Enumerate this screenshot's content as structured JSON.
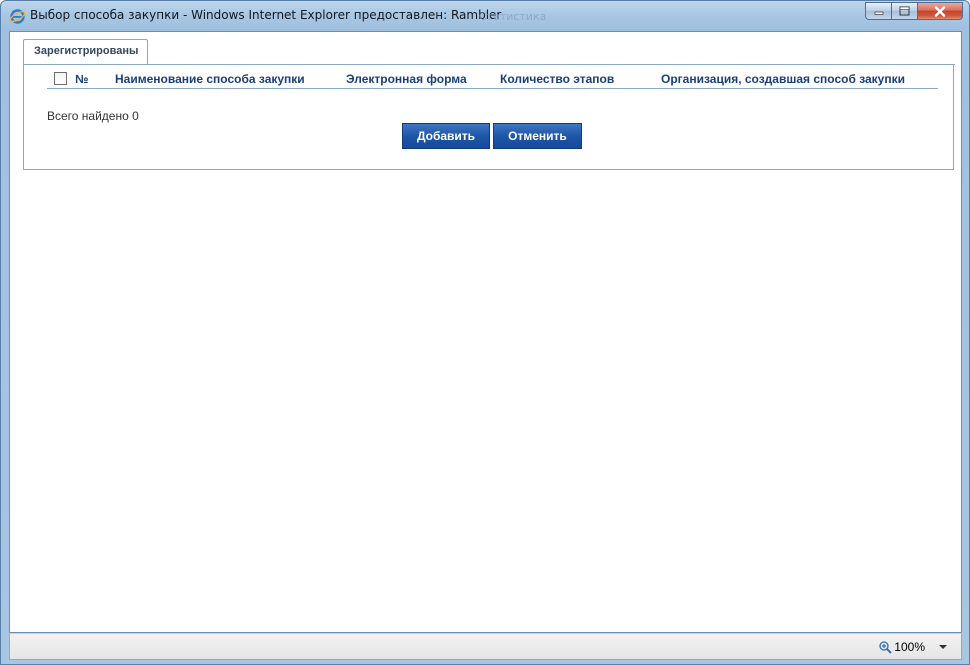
{
  "window": {
    "title": "Выбор способа закупки - Windows Internet Explorer предоставлен: Rambler",
    "background_tab_hint": "Статистика"
  },
  "tabs": [
    {
      "label": "Зарегистрированы",
      "active": true
    }
  ],
  "table": {
    "columns": [
      "№",
      "Наименование способа закупки",
      "Электронная форма",
      "Количество этапов",
      "Организация, создавшая способ закупки"
    ],
    "rows": []
  },
  "summary": {
    "found_text": "Всего найдено 0"
  },
  "buttons": {
    "add": "Добавить",
    "cancel": "Отменить"
  },
  "statusbar": {
    "zoom": "100%"
  },
  "colors": {
    "header_text": "#1a3f7d",
    "button_bg": "#1d57a8",
    "border": "#8ea9c7"
  }
}
